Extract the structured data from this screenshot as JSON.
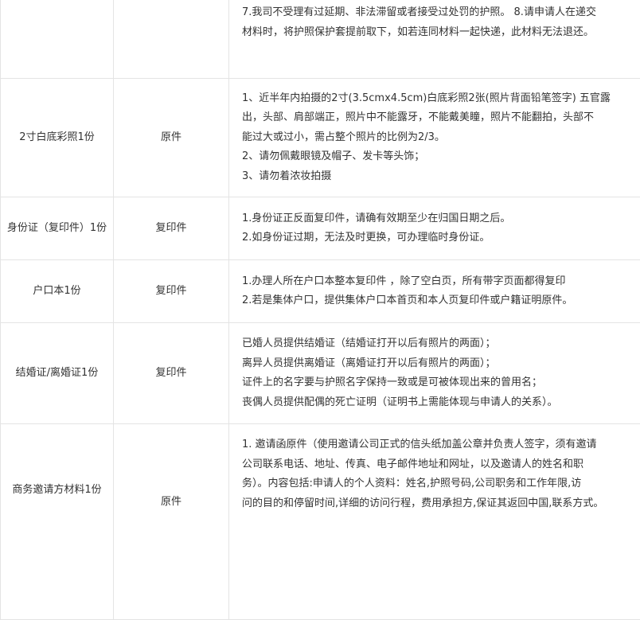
{
  "rows": [
    {
      "name": "",
      "type": "",
      "lines": [
        "7.我司不受理有过延期、非法滞留或者接受过处罚的护照。 8.请申请人在递交",
        "材料时，将护照保护套提前取下，如若连同材料一起快递，此材料无法退还。"
      ]
    },
    {
      "name": "2寸白底彩照1份",
      "type": "原件",
      "lines": [
        "1、近半年内拍摄的2寸(3.5cmx4.5cm)白底彩照2张(照片背面铅笔签字) 五官露",
        "出，头部、肩部端正，照片中不能露牙，不能戴美瞳，照片不能翻拍，头部不",
        "能过大或过小，需占整个照片的比例为2/3。",
        "2、请勿佩戴眼镜及帽子、发卡等头饰；",
        "3、请勿着浓妆拍摄"
      ]
    },
    {
      "name": "身份证（复印件）1份",
      "type": "复印件",
      "lines": [
        "1.身份证正反面复印件，请确有效期至少在归国日期之后。",
        "2.如身份证过期，无法及时更换，可办理临时身份证。"
      ]
    },
    {
      "name": "户口本1份",
      "type": "复印件",
      "lines": [
        "1.办理人所在户口本整本复印件 ，除了空白页，所有带字页面都得复印",
        "2.若是集体户口，提供集体户口本首页和本人页复印件或户籍证明原件。"
      ]
    },
    {
      "name": "结婚证/离婚证1份",
      "type": "复印件",
      "lines": [
        "已婚人员提供结婚证（结婚证打开以后有照片的两面）；",
        "离异人员提供离婚证（离婚证打开以后有照片的两面）；",
        "证件上的名字要与护照名字保持一致或是可被体现出来的曾用名；",
        "丧偶人员提供配偶的死亡证明（证明书上需能体现与申请人的关系）。"
      ]
    },
    {
      "name": "商务邀请方材料1份",
      "type": "原件",
      "lines": [
        "1. 邀请函原件（使用邀请公司正式的信头纸加盖公章并负责人签字，须有邀请",
        "公司联系电话、地址、传真、电子邮件地址和网址，以及邀请人的姓名和职",
        "务）。内容包括:申请人的个人资料：姓名,护照号码,公司职务和工作年限,访",
        "问的目的和停留时间,详细的访问行程，费用承担方,保证其返回中国,联系方式。"
      ]
    }
  ]
}
